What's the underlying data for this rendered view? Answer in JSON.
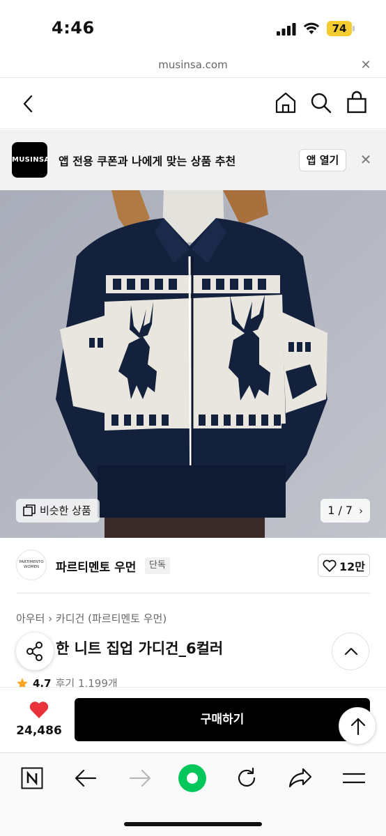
{
  "status_bar": {
    "time": "4:46",
    "battery": "74"
  },
  "url_bar": {
    "domain": "musinsa.com",
    "close_icon": "close-icon"
  },
  "header": {
    "icons": [
      "back-icon",
      "home-icon",
      "search-icon",
      "cart-icon"
    ]
  },
  "app_banner": {
    "logo_text": "MUSINSA",
    "message": "앱 전용 쿠폰과 나에게 맞는 상품 추천",
    "button_label": "앱 열기"
  },
  "product_image": {
    "similar_label": "비슷한 상품",
    "counter": "1 / 7"
  },
  "brand": {
    "logo_text_line1": "PARTIMENTO",
    "logo_text_line2": "WOMEN",
    "name": "파르티멘토 우먼",
    "badge": "단독",
    "like_count": "12만"
  },
  "product": {
    "breadcrumb_1": "아우터",
    "breadcrumb_2": "카디건 (파르티멘토 우먼)",
    "title": "한 니트 집업 가디건_6컬러",
    "rating": "4.7",
    "reviews": "후기 1,199개"
  },
  "purchase": {
    "heart_count": "24,486",
    "buy_label": "구매하기"
  },
  "colors": {
    "accent_heart": "#e8333a",
    "battery": "#f5cc30",
    "naver_green": "#03c75a",
    "star": "#f6a623"
  }
}
